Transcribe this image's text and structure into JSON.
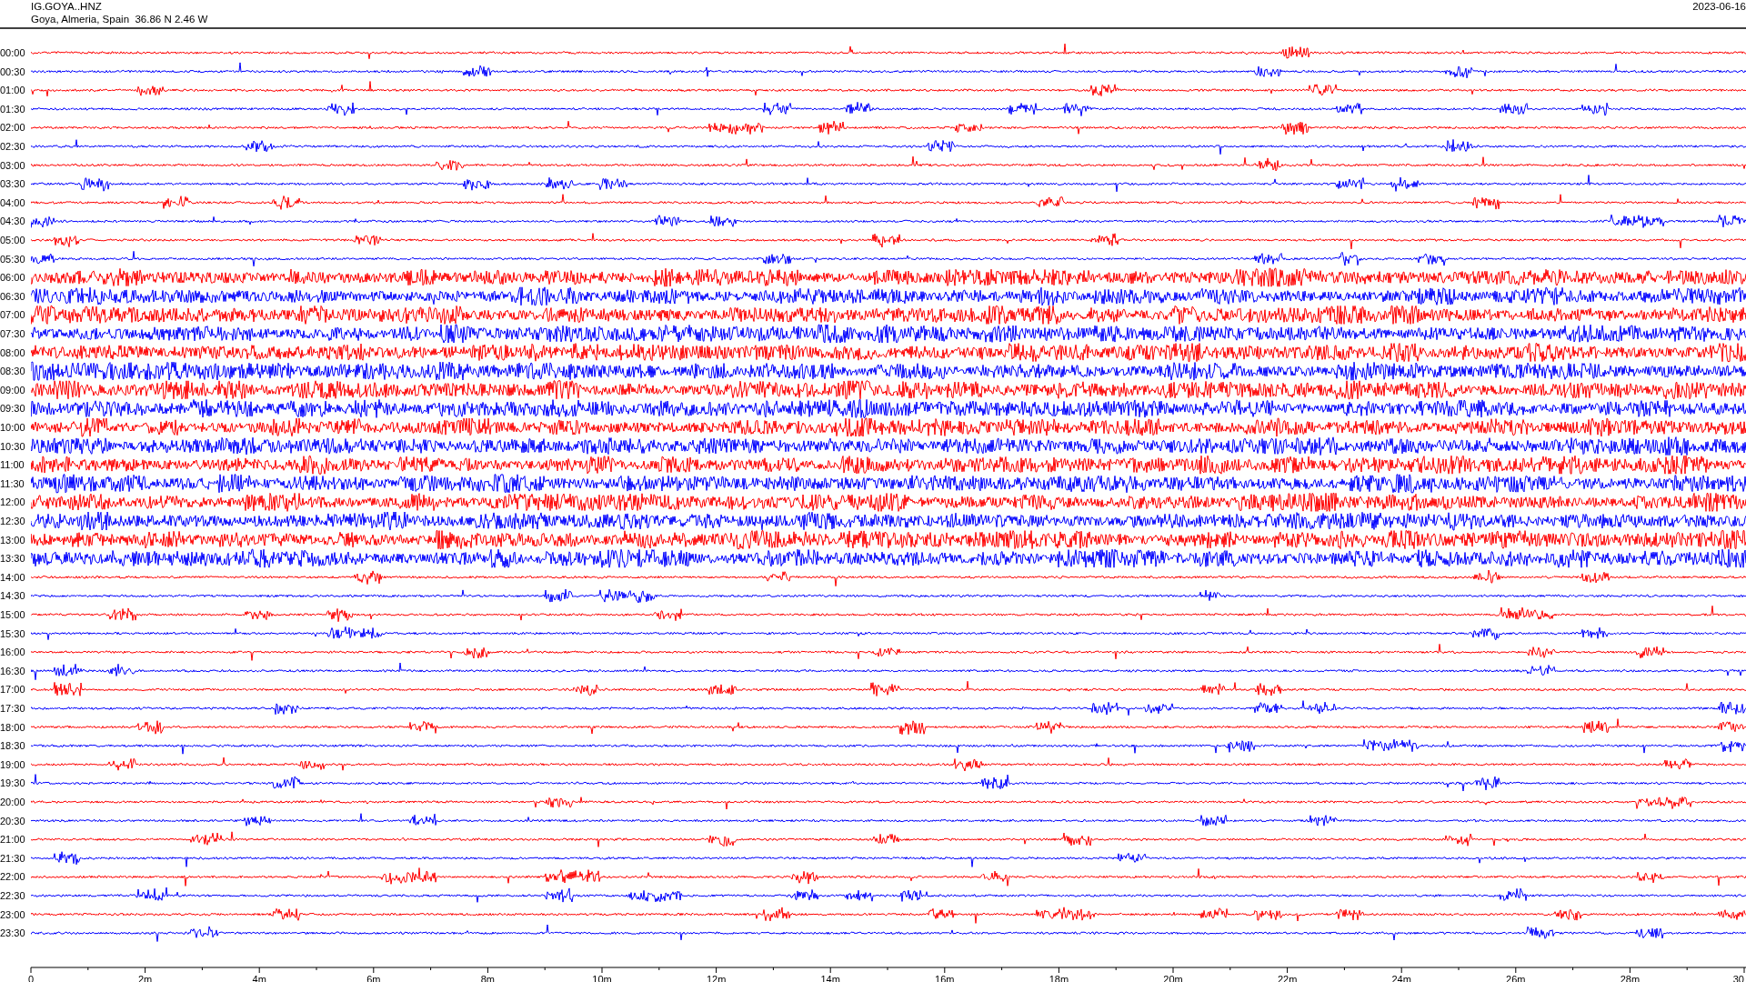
{
  "header": {
    "station": "IG.GOYA..HNZ",
    "location": "Goya, Almeria, Spain  36.86 N 2.46 W",
    "date": "2023-06-16"
  },
  "rows": [
    {
      "label": "00:00",
      "color": "#ff0000"
    },
    {
      "label": "00:30",
      "color": "#0000ff"
    },
    {
      "label": "01:00",
      "color": "#ff0000"
    },
    {
      "label": "01:30",
      "color": "#0000ff"
    },
    {
      "label": "02:00",
      "color": "#ff0000"
    },
    {
      "label": "02:30",
      "color": "#0000ff"
    },
    {
      "label": "03:00",
      "color": "#ff0000"
    },
    {
      "label": "03:30",
      "color": "#0000ff"
    },
    {
      "label": "04:00",
      "color": "#ff0000"
    },
    {
      "label": "04:30",
      "color": "#0000ff"
    },
    {
      "label": "05:00",
      "color": "#ff0000"
    },
    {
      "label": "05:30",
      "color": "#0000ff"
    },
    {
      "label": "06:00",
      "color": "#ff0000"
    },
    {
      "label": "06:30",
      "color": "#0000ff"
    },
    {
      "label": "07:00",
      "color": "#ff0000"
    },
    {
      "label": "07:30",
      "color": "#0000ff"
    },
    {
      "label": "08:00",
      "color": "#ff0000"
    },
    {
      "label": "08:30",
      "color": "#0000ff"
    },
    {
      "label": "09:00",
      "color": "#ff0000"
    },
    {
      "label": "09:30",
      "color": "#0000ff"
    },
    {
      "label": "10:00",
      "color": "#ff0000"
    },
    {
      "label": "10:30",
      "color": "#0000ff"
    },
    {
      "label": "11:00",
      "color": "#ff0000"
    },
    {
      "label": "11:30",
      "color": "#0000ff"
    },
    {
      "label": "12:00",
      "color": "#ff0000"
    },
    {
      "label": "12:30",
      "color": "#0000ff"
    },
    {
      "label": "13:00",
      "color": "#ff0000"
    },
    {
      "label": "13:30",
      "color": "#0000ff"
    },
    {
      "label": "14:00",
      "color": "#ff0000"
    },
    {
      "label": "14:30",
      "color": "#0000ff"
    },
    {
      "label": "15:00",
      "color": "#ff0000"
    },
    {
      "label": "15:30",
      "color": "#0000ff"
    },
    {
      "label": "16:00",
      "color": "#ff0000"
    },
    {
      "label": "16:30",
      "color": "#0000ff"
    },
    {
      "label": "17:00",
      "color": "#ff0000"
    },
    {
      "label": "17:30",
      "color": "#0000ff"
    },
    {
      "label": "18:00",
      "color": "#ff0000"
    },
    {
      "label": "18:30",
      "color": "#0000ff"
    },
    {
      "label": "19:00",
      "color": "#ff0000"
    },
    {
      "label": "19:30",
      "color": "#0000ff"
    },
    {
      "label": "20:00",
      "color": "#ff0000"
    },
    {
      "label": "20:30",
      "color": "#0000ff"
    },
    {
      "label": "21:00",
      "color": "#ff0000"
    },
    {
      "label": "21:30",
      "color": "#0000ff"
    },
    {
      "label": "22:00",
      "color": "#ff0000"
    },
    {
      "label": "22:30",
      "color": "#0000ff"
    },
    {
      "label": "23:00",
      "color": "#ff0000"
    },
    {
      "label": "23:30",
      "color": "#0000ff"
    }
  ],
  "x_axis": {
    "tick_labels": [
      "0",
      "2m",
      "4m",
      "6m",
      "8m",
      "10m",
      "12m",
      "14m",
      "16m",
      "18m",
      "20m",
      "22m",
      "24m",
      "26m",
      "28m",
      "30"
    ]
  }
}
